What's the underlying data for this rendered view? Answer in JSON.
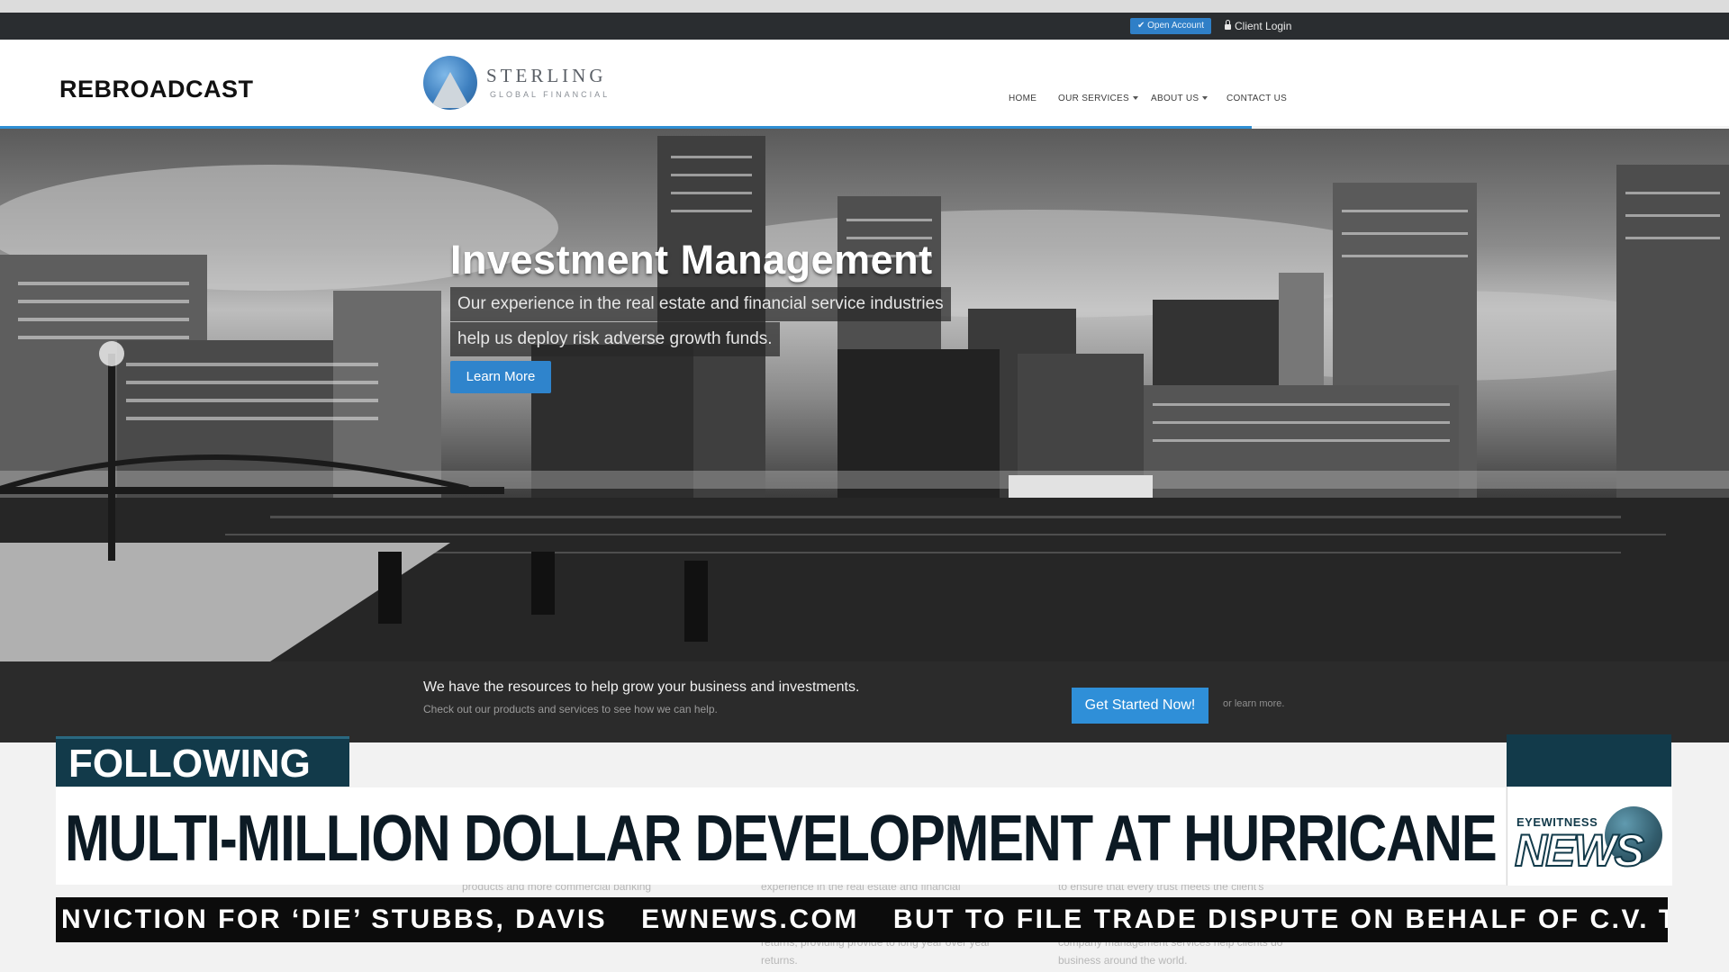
{
  "browser": {
    "url_fragment": "ewnews.com"
  },
  "overlay": {
    "rebroadcast": "REBROADCAST"
  },
  "site": {
    "topbar": {
      "open_account": "✔ Open Account",
      "client_login": "Client Login"
    },
    "logo": {
      "word": "STERLING",
      "sub": "GLOBAL FINANCIAL"
    },
    "nav": {
      "home": "HOME",
      "services": "OUR SERVICES",
      "about": "ABOUT US",
      "contact": "CONTACT US"
    },
    "hero": {
      "title": "Investment Management",
      "line1": "Our experience in the real estate and financial service industries",
      "line2": "help us deploy risk adverse growth funds.",
      "button": "Learn More"
    },
    "cta": {
      "heading": "We have the resources to help grow your business and investments.",
      "sub": "Check out our products and services to see how we can help.",
      "button": "Get Started Now!",
      "alt_link": "or learn more."
    },
    "faded": {
      "col1": "products and more commercial banking",
      "col2": "experience in the real estate and financial",
      "col3": "to ensure that every trust meets the client's",
      "col2b": "returns, providing provide to long year over year",
      "col2c": "returns.",
      "col3b": "company management services help clients do",
      "col3c": "business around the world."
    }
  },
  "news": {
    "tag": "FOLLOWING",
    "headline": "MULTI-MILLION DOLLAR DEVELOPMENT AT HURRICANE HOLE",
    "logo_top": "EYEWITNESS",
    "logo_main": "NEWS",
    "ticker": {
      "item1": "NVICTION FOR ‘DIE’ STUBBS, DAVIS",
      "item2": "EWNEWS.COM",
      "item3": "BUT TO FILE TRADE DISPUTE ON BEHALF OF C.V. T"
    }
  },
  "colors": {
    "brand_blue": "#2f8fd4",
    "news_teal": "#123a4a",
    "ticker_bg": "#0c0c0c"
  }
}
